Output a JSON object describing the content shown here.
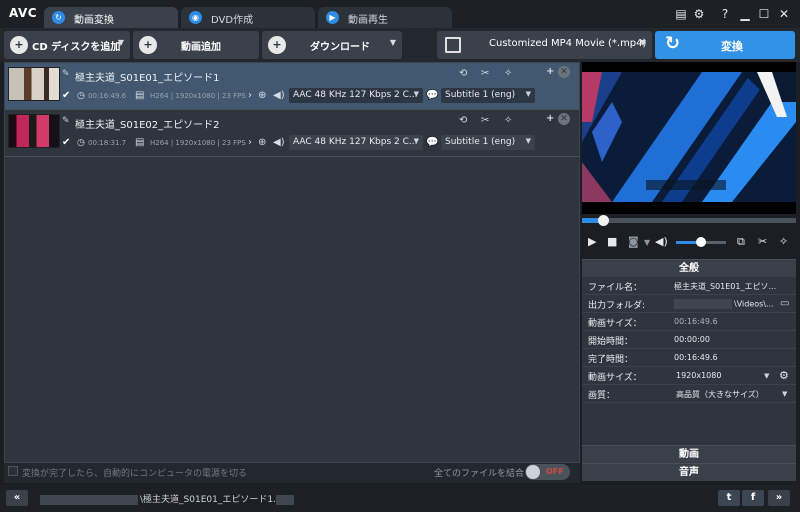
{
  "app": {
    "logo": "AVC"
  },
  "tabs": [
    {
      "label": "動画変換",
      "icon": "refresh-icon",
      "active": true
    },
    {
      "label": "DVD作成",
      "icon": "disc-icon",
      "active": false
    },
    {
      "label": "動画再生",
      "icon": "play-icon",
      "active": false
    }
  ],
  "window_controls": {
    "help": "?"
  },
  "toolbar": {
    "add_cd": "CD ディスクを追加",
    "add_video": "動画追加",
    "download": "ダウンロード",
    "profile": "Customized MP4 Movie (*.mp4)",
    "convert": "変換"
  },
  "files": [
    {
      "name": "極主夫道_S01E01_エピソード1",
      "duration": "00:16:49.6",
      "video_info": "H264 | 1920x1080 | 23 FPS",
      "audio": "AAC 48 KHz 127 Kbps 2 C...",
      "subtitle": "Subtitle 1 (eng)",
      "checked": true,
      "selected": true
    },
    {
      "name": "極主夫道_S01E02_エピソード2",
      "duration": "00:18:31.7",
      "video_info": "H264 | 1920x1080 | 23 FPS",
      "audio": "AAC 48 KHz 127 Kbps 2 C...",
      "subtitle": "Subtitle 1 (eng)",
      "checked": true,
      "selected": false
    }
  ],
  "list_footer": {
    "shutdown_option": "変換が完了したら、自動的にコンピュータの電源を切る",
    "merge_label": "全てのファイルを結合",
    "merge_toggle": "OFF"
  },
  "player": {
    "seek_progress": 0.1,
    "volume": 0.5
  },
  "properties": {
    "general_header": "全般",
    "rows": [
      {
        "label": "ファイル名：",
        "value": "極主夫道_S01E01_エピソ..."
      },
      {
        "label": "出力フォルダ:",
        "value": "\\Videos\\..."
      },
      {
        "label": "動画サイズ：",
        "value": "00:16:49.6"
      },
      {
        "label": "開始時間：",
        "value": "00:00:00"
      },
      {
        "label": "完了時間：",
        "value": "00:16:49.6"
      },
      {
        "label": "動画サイズ：",
        "value": "1920x1080"
      },
      {
        "label": "画質：",
        "value": "高品質（大きなサイズ）"
      }
    ],
    "video_header": "動画",
    "audio_header": "音声"
  },
  "statusbar": {
    "path": "\\極主夫道_S01E01_エピソード1."
  },
  "colors": {
    "accent": "#2e8ce5",
    "toggle_off": "#d24a3d"
  }
}
